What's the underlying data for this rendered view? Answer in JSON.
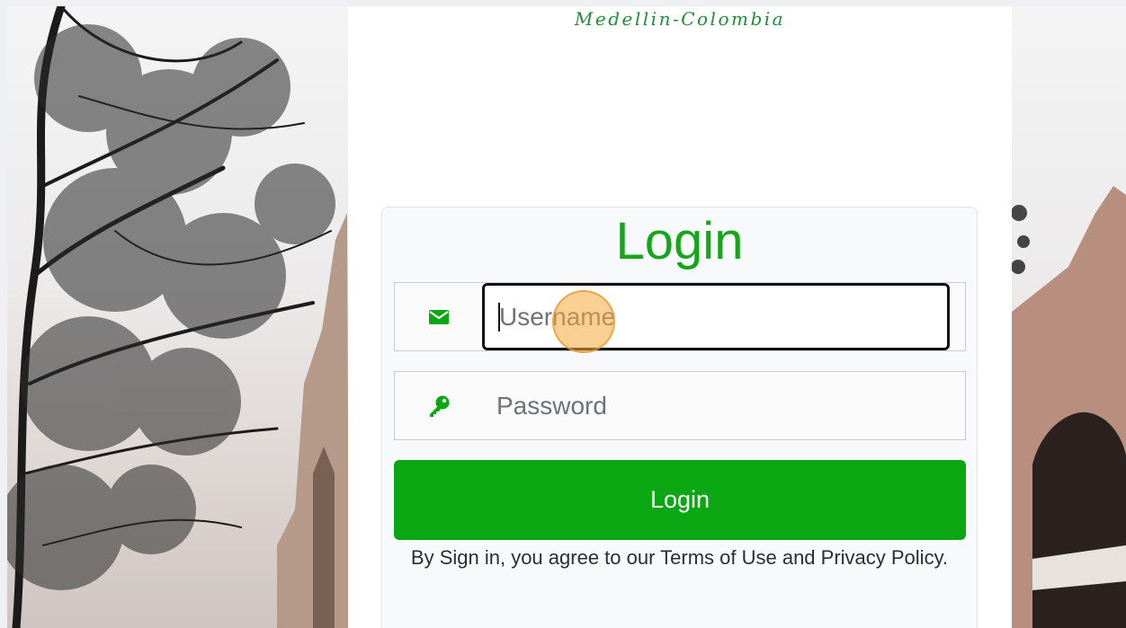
{
  "brand": {
    "subtitle": "Medellin-Colombia"
  },
  "login_card": {
    "title": "Login",
    "username": {
      "placeholder": "Username",
      "icon": "envelope-icon"
    },
    "password": {
      "placeholder": "Password",
      "icon": "key-icon"
    },
    "submit_label": "Login",
    "terms_text": "By Sign in, you agree to our Terms of Use and Privacy Policy."
  },
  "colors": {
    "accent": "#0aa712",
    "title": "#16a61b",
    "brand": "#1d8f35"
  }
}
